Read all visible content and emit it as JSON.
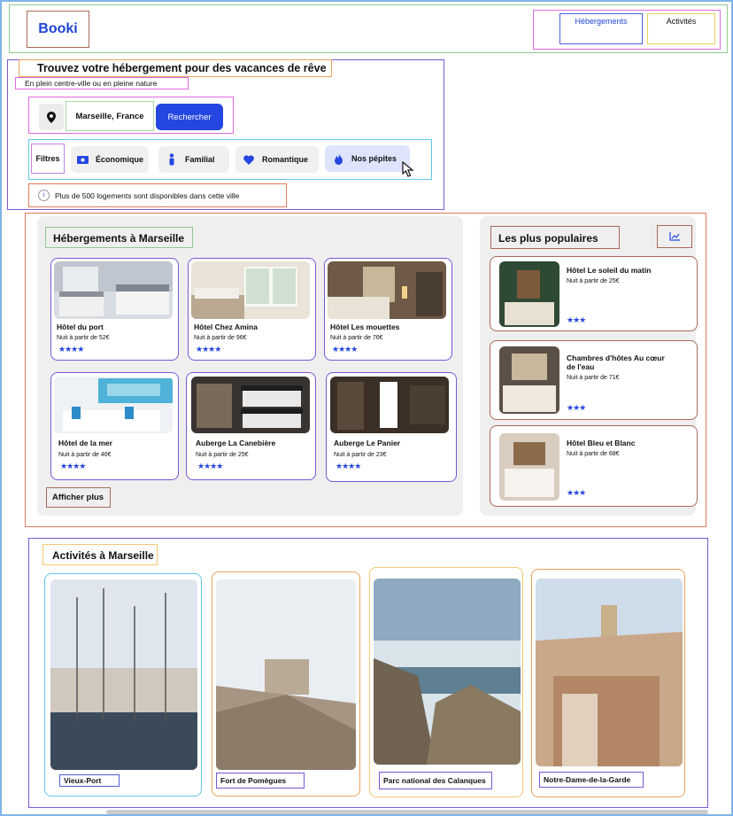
{
  "brand": {
    "logo": "Booki"
  },
  "nav": {
    "items": [
      "Hébergements",
      "Activités"
    ]
  },
  "hero": {
    "title": "Trouvez votre hébergement pour des vacances de rêve",
    "subtitle": "En plein centre-ville ou en pleine nature",
    "location_value": "Marseille, France",
    "search_label": "Rechercher",
    "filters_label": "Filtres",
    "filters": [
      "Économique",
      "Familial",
      "Romantique",
      "Nos pépites"
    ],
    "info": "Plus de 500 logements sont disponibles dans cette ville"
  },
  "accommodations": {
    "title": "Hébergements à Marseille",
    "more": "Afficher plus",
    "items": [
      {
        "name": "Hôtel du port",
        "price": "Nuit à partir de 52€",
        "stars": 4
      },
      {
        "name": "Hôtel Chez Amina",
        "price": "Nuit à partir de 96€",
        "stars": 4
      },
      {
        "name": "Hôtel Les mouettes",
        "price": "Nuit à partir de 76€",
        "stars": 4
      },
      {
        "name": "Hôtel de la mer",
        "price": "Nuit à partir de 46€",
        "stars": 4
      },
      {
        "name": "Auberge La Canebière",
        "price": "Nuit à partir de 25€",
        "stars": 4
      },
      {
        "name": "Auberge Le Panier",
        "price": "Nuit à partir de 23€",
        "stars": 4
      }
    ]
  },
  "popular": {
    "title": "Les plus populaires",
    "items": [
      {
        "name": "Hôtel Le soleil du matin",
        "price": "Nuit à partir de 25€",
        "stars": 3
      },
      {
        "name": "Chambres d'hôtes Au cœur de l'eau",
        "price": "Nuit à partir de 71€",
        "stars": 3
      },
      {
        "name": "Hôtel Bleu et Blanc",
        "price": "Nuit à partir de 68€",
        "stars": 3
      }
    ]
  },
  "activities": {
    "title": "Activités à Marseille",
    "items": [
      "Vieux-Port",
      "Fort de Pomègues",
      "Parc national des Calanques",
      "Notre-Dame-de-la-Garde"
    ]
  },
  "colors": {
    "accent": "#2546e0",
    "panel": "#efefef"
  },
  "icons": [
    "location-pin-icon",
    "money-icon",
    "family-icon",
    "heart-icon",
    "fire-icon",
    "info-icon",
    "trend-chart-icon",
    "star-icon",
    "cursor-icon"
  ]
}
